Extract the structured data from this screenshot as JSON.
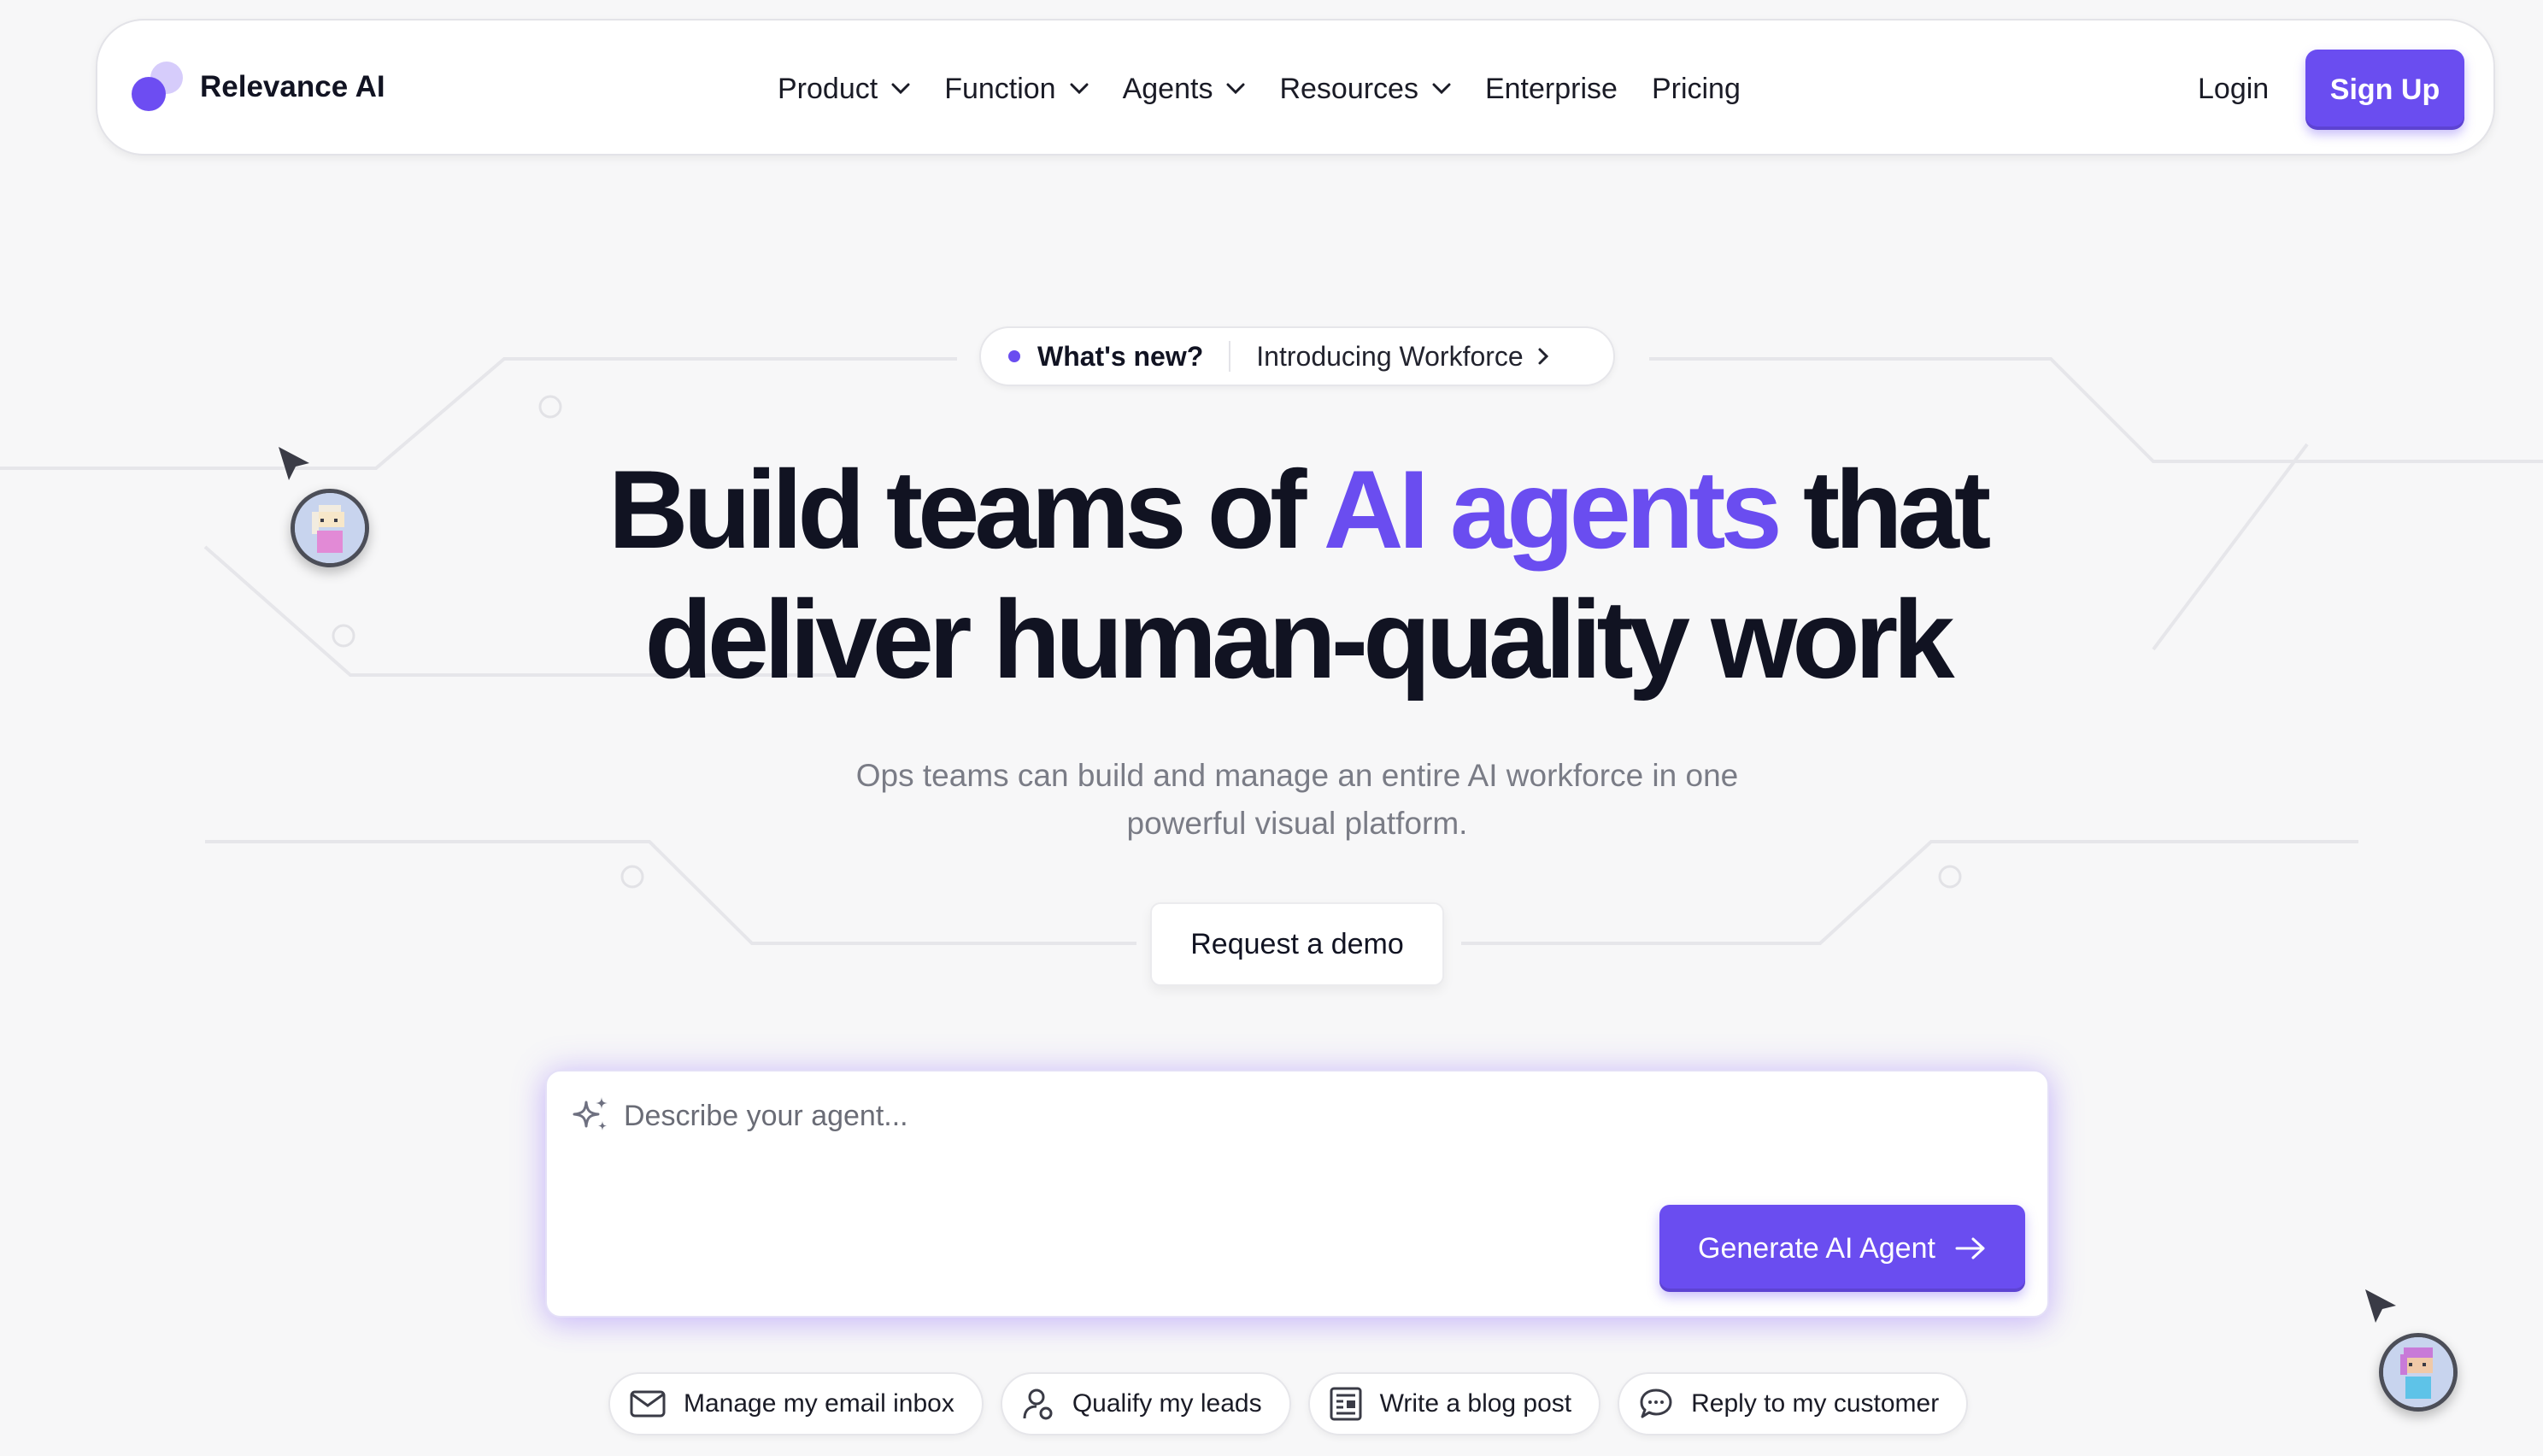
{
  "brand": {
    "name": "Relevance AI"
  },
  "nav": {
    "items": [
      {
        "label": "Product",
        "has_dropdown": true
      },
      {
        "label": "Function",
        "has_dropdown": true
      },
      {
        "label": "Agents",
        "has_dropdown": true
      },
      {
        "label": "Resources",
        "has_dropdown": true
      },
      {
        "label": "Enterprise",
        "has_dropdown": false
      },
      {
        "label": "Pricing",
        "has_dropdown": false
      }
    ],
    "login": "Login",
    "signup": "Sign Up"
  },
  "announcement": {
    "badge": "What's new?",
    "text": "Introducing Workforce"
  },
  "hero": {
    "title_part1": "Build teams of ",
    "title_highlight": "AI agents",
    "title_part2": " that",
    "title_line2": "deliver human-quality work",
    "subtitle_line1": "Ops teams can build and manage an entire AI workforce in one",
    "subtitle_line2": "powerful visual platform.",
    "demo_button": "Request a demo"
  },
  "agent_prompt": {
    "placeholder": "Describe your agent...",
    "generate_button": "Generate AI Agent"
  },
  "suggestions": [
    {
      "label": "Manage my email inbox",
      "icon": "mail-icon"
    },
    {
      "label": "Qualify my leads",
      "icon": "user-check-icon"
    },
    {
      "label": "Write a blog post",
      "icon": "document-icon"
    },
    {
      "label": "Reply to my customer",
      "icon": "chat-bubble-icon"
    }
  ],
  "colors": {
    "accent": "#6a4df0",
    "text": "#111322",
    "muted": "#7a7c86",
    "background": "#f7f7f8"
  }
}
